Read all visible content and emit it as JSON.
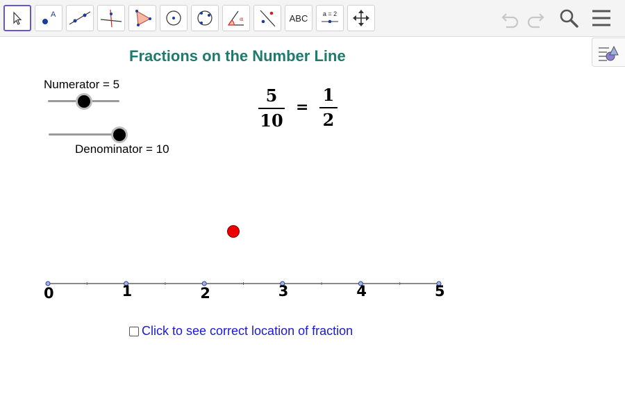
{
  "toolbar": {
    "abc_label": "ABC",
    "slider_label": "a = 2",
    "colors": {
      "accent": "#6557d2",
      "point": "#1a3d9e"
    }
  },
  "graphics": {
    "title": "Fractions on the Number Line",
    "numerator_label": "Numerator = 5",
    "denominator_label": "Denominator = 10",
    "numerator_slider": {
      "value": 5,
      "min": 0,
      "max": 10
    },
    "denominator_slider": {
      "value": 10,
      "min": 1,
      "max": 10
    },
    "fraction": {
      "numerator": "5",
      "denominator": "10"
    },
    "equals": "=",
    "simplified": {
      "numerator": "1",
      "denominator": "2"
    },
    "number_line_labels": [
      "0",
      "1",
      "2",
      "3",
      "4",
      "5"
    ],
    "checkbox_label": "Click to see correct location of fraction",
    "checkbox_checked": false,
    "colors": {
      "title": "#1f7a6e",
      "point": "#ee0000",
      "checkbox_text": "#1a1ad4"
    }
  }
}
